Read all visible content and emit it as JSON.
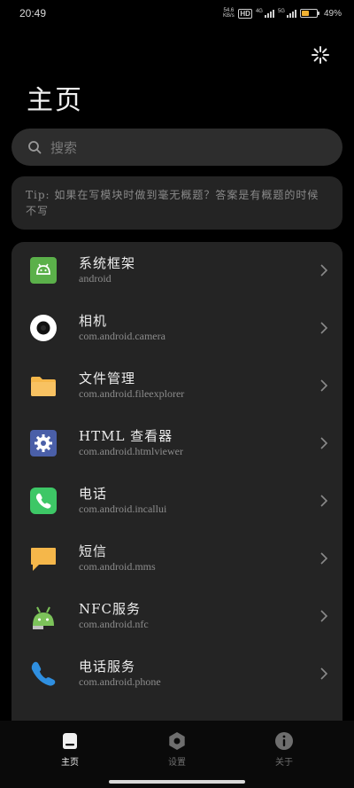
{
  "status_bar": {
    "time": "20:49",
    "net_speed_value": "54.6",
    "net_speed_unit": "KB/s",
    "hd_label": "HD",
    "sim1_tag": "4G",
    "sim2_tag": "5G",
    "battery_percent": 49,
    "battery_label": "49%"
  },
  "page": {
    "title": "主页"
  },
  "search": {
    "placeholder": "搜索"
  },
  "tip": {
    "text": "Tip: 如果在写模块时做到毫无概题？答案是有概题的时候不写"
  },
  "apps": [
    {
      "name": "系统框架",
      "package": "android",
      "icon": "android-framework-icon",
      "color": "#5bb04a"
    },
    {
      "name": "相机",
      "package": "com.android.camera",
      "icon": "camera-icon",
      "color": "#ffffff"
    },
    {
      "name": "文件管理",
      "package": "com.android.fileexplorer",
      "icon": "folder-icon",
      "color": "#f5b74a"
    },
    {
      "name": "HTML 查看器",
      "package": "com.android.htmlviewer",
      "icon": "gear-icon",
      "color": "#4a5fa8"
    },
    {
      "name": "电话",
      "package": "com.android.incallui",
      "icon": "phone-icon",
      "color": "#3dc766"
    },
    {
      "name": "短信",
      "package": "com.android.mms",
      "icon": "message-icon",
      "color": "#f5b74a"
    },
    {
      "name": "NFC服务",
      "package": "com.android.nfc",
      "icon": "android-robot-icon",
      "color": "#7cc35a"
    },
    {
      "name": "电话服务",
      "package": "com.android.phone",
      "icon": "phone-service-icon",
      "color": "#2f8fe0"
    }
  ],
  "nav": {
    "items": [
      {
        "label": "主页",
        "icon": "home-icon",
        "active": true
      },
      {
        "label": "设置",
        "icon": "settings-icon",
        "active": false
      },
      {
        "label": "关于",
        "icon": "info-icon",
        "active": false
      }
    ]
  },
  "colors": {
    "background": "#000000",
    "card": "#242424",
    "search": "#2d2d2d",
    "nav_active": "#f0f0f0",
    "nav_inactive": "#6e6e6e"
  }
}
